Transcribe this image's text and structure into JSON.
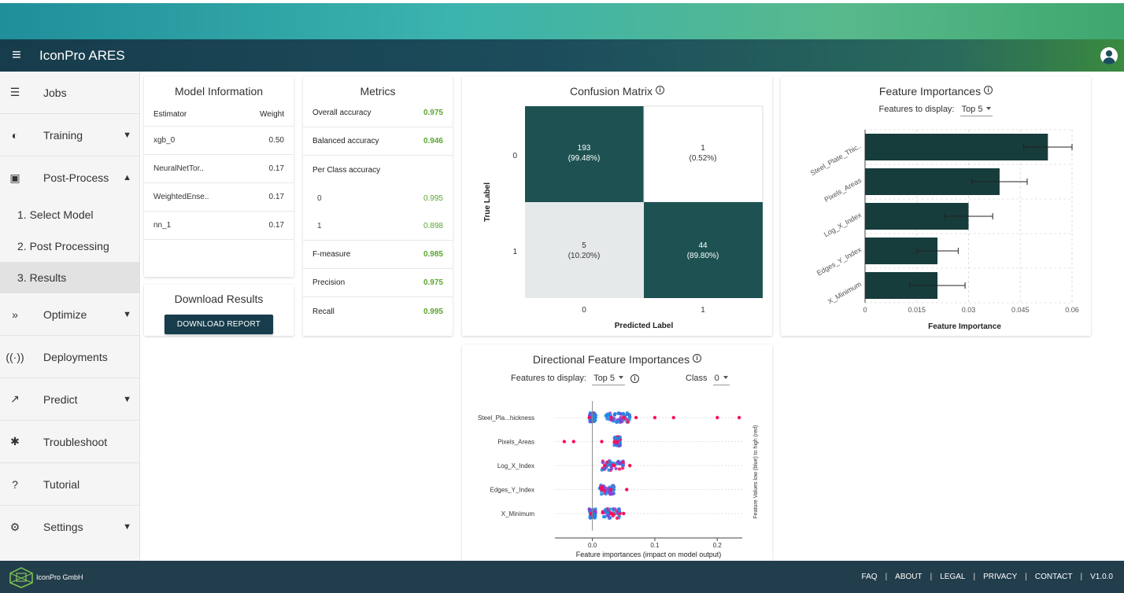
{
  "app": {
    "title": "IconPro ARES"
  },
  "colors": {
    "primary": "#173c4c",
    "matrix_dark": "#1e5252",
    "matrix_light": "#e6e9ea",
    "accent_green": "#5aa531",
    "shap_blue": "#1e88e5",
    "shap_red": "#ff0d57"
  },
  "sidebar": {
    "items": [
      {
        "label": "Jobs",
        "icon": "list-icon"
      },
      {
        "label": "Training",
        "icon": "training-icon",
        "chevron": "down"
      },
      {
        "label": "Post-Process",
        "icon": "chart-icon",
        "chevron": "up"
      },
      {
        "label": "Optimize",
        "icon": "double-chevron-icon",
        "chevron": "down"
      },
      {
        "label": "Deployments",
        "icon": "antenna-icon"
      },
      {
        "label": "Predict",
        "icon": "trend-icon",
        "chevron": "down"
      },
      {
        "label": "Troubleshoot",
        "icon": "bug-icon"
      },
      {
        "label": "Tutorial",
        "icon": "help-icon"
      },
      {
        "label": "Settings",
        "icon": "gear-icon",
        "chevron": "down"
      }
    ],
    "post_process_sub": [
      "1. Select Model",
      "2. Post Processing",
      "3. Results"
    ],
    "active_sub": "3. Results"
  },
  "model_info": {
    "title": "Model Information",
    "headers": [
      "Estimator",
      "Weight"
    ],
    "rows": [
      {
        "name": "xgb_0",
        "weight": "0.50"
      },
      {
        "name": "NeuralNetTor..",
        "weight": "0.17"
      },
      {
        "name": "WeightedEnse..",
        "weight": "0.17"
      },
      {
        "name": "nn_1",
        "weight": "0.17"
      }
    ]
  },
  "download": {
    "title": "Download Results",
    "button": "DOWNLOAD REPORT"
  },
  "metrics": {
    "title": "Metrics",
    "overall_label": "Overall accuracy",
    "overall": "0.975",
    "balanced_label": "Balanced accuracy",
    "balanced": "0.946",
    "per_class_label": "Per Class accuracy",
    "class0_label": "0",
    "class0": "0.995",
    "class1_label": "1",
    "class1": "0.898",
    "f_label": "F-measure",
    "f": "0.985",
    "precision_label": "Precision",
    "precision": "0.975",
    "recall_label": "Recall",
    "recall": "0.995"
  },
  "confusion": {
    "title": "Confusion Matrix",
    "ylabel": "True Label",
    "xlabel": "Predicted Label",
    "row_labels": [
      "0",
      "1"
    ],
    "col_labels": [
      "0",
      "1"
    ],
    "cells": [
      {
        "count": "193",
        "pct": "(99.48%)"
      },
      {
        "count": "1",
        "pct": "(0.52%)"
      },
      {
        "count": "5",
        "pct": "(10.20%)"
      },
      {
        "count": "44",
        "pct": "(89.80%)"
      }
    ]
  },
  "feature_importances": {
    "title": "Feature Importances",
    "features_label": "Features to display:",
    "features_value": "Top 5"
  },
  "directional": {
    "title": "Directional Feature Importances",
    "features_label": "Features to display:",
    "features_value": "Top 5",
    "class_label": "Class",
    "class_value": "0"
  },
  "chart_data": [
    {
      "type": "bar",
      "orientation": "horizontal",
      "categories": [
        "Steel_Plate_Thic..",
        "Pixels_Areas",
        "Log_X_Index",
        "Edges_Y_Index",
        "X_Minimum"
      ],
      "values": [
        0.053,
        0.039,
        0.03,
        0.021,
        0.021
      ],
      "error": [
        0.007,
        0.008,
        0.007,
        0.006,
        0.008
      ],
      "xlabel": "Feature Importance",
      "xlim": [
        0,
        0.06
      ],
      "xticks": [
        "0",
        "0.015",
        "0.03",
        "0.045",
        "0.06"
      ],
      "grid": true
    },
    {
      "type": "scatter",
      "categories": [
        "Steel_Pla...hickness",
        "Pixels_Areas",
        "Log_X_Index",
        "Edges_Y_Index",
        "X_Minimum"
      ],
      "xlabel": "Feature importances (impact on model output)",
      "colorbar_label": "Feature Values low (blue) to high (red)",
      "xlim": [
        -0.06,
        0.24
      ],
      "xticks": [
        "0.0",
        "0.1",
        "0.2"
      ],
      "series": [
        {
          "x": [
            -0.005,
            0.03,
            0.05,
            0.07,
            0.1,
            0.13,
            0.2,
            0.235
          ]
        },
        {
          "x": [
            -0.045,
            -0.03,
            0.015,
            0.04
          ]
        },
        {
          "x": [
            0.02,
            0.035,
            0.06
          ]
        },
        {
          "x": [
            0.015,
            0.03,
            0.055
          ]
        },
        {
          "x": [
            -0.002,
            0.03,
            0.05
          ]
        }
      ]
    }
  ],
  "footer": {
    "company": "IconPro GmbH",
    "links": [
      "FAQ",
      "ABOUT",
      "LEGAL",
      "PRIVACY",
      "CONTACT",
      "V1.0.0"
    ]
  }
}
